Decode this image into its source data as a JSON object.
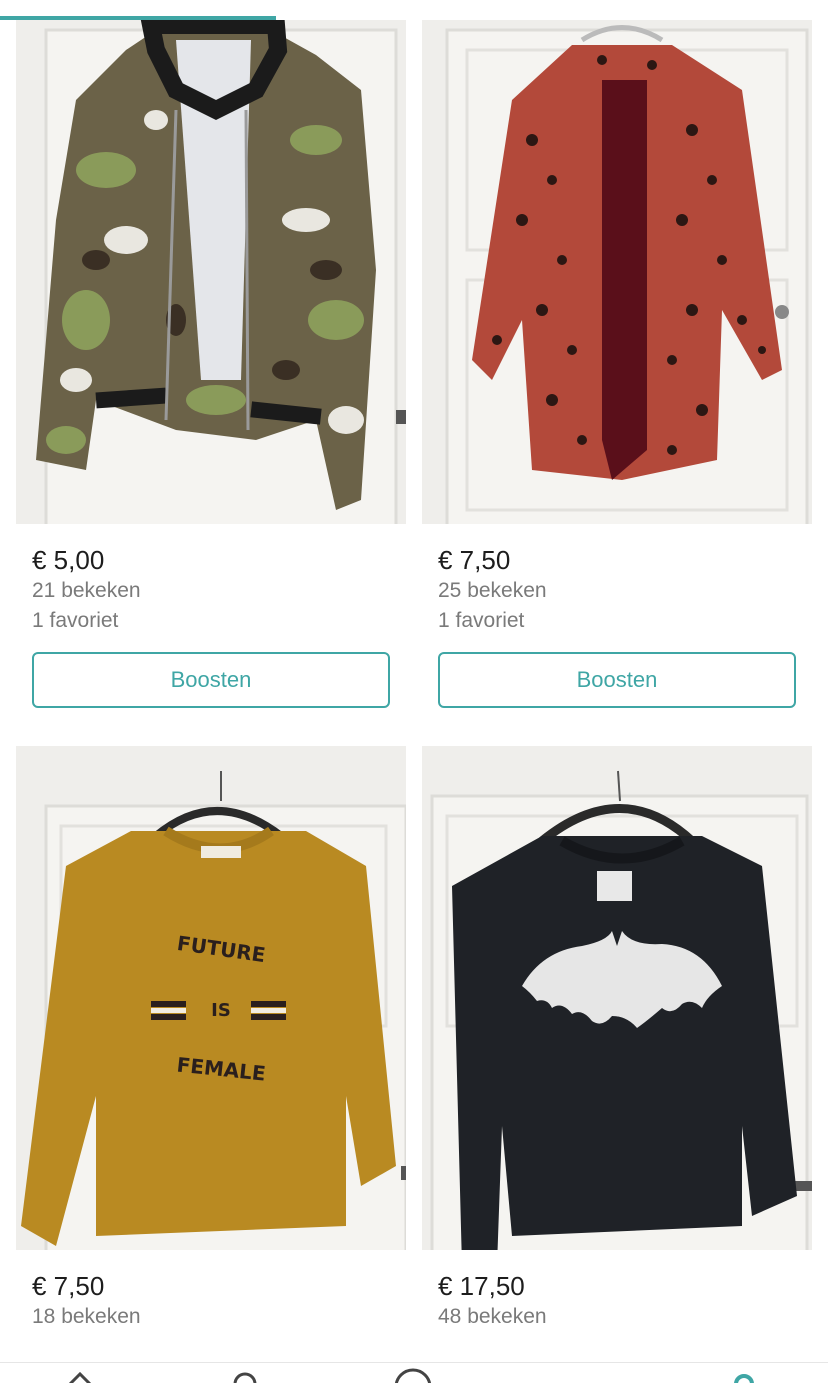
{
  "accent_color": "#3fa6a5",
  "top_progress": {
    "fraction": 0.333
  },
  "items": [
    {
      "price": "€ 5,00",
      "views": "21 bekeken",
      "favorites": "1 favoriet",
      "boost_label": "Boosten",
      "image": "camouflage-bomber-jacket"
    },
    {
      "price": "€ 7,50",
      "views": "25 bekeken",
      "favorites": "1 favoriet",
      "boost_label": "Boosten",
      "image": "leopard-print-coat"
    },
    {
      "price": "€ 7,50",
      "views": "18 bekeken",
      "image": "mustard-sweater-future-is-female",
      "shirt_text": [
        "FUTURE",
        "IS",
        "FEMALE"
      ]
    },
    {
      "price": "€ 17,50",
      "views": "48 bekeken",
      "image": "black-bat-sweater"
    }
  ],
  "bottom_nav": {
    "icons": [
      "home-icon",
      "search-icon",
      "sell-icon",
      "profile-icon"
    ]
  }
}
